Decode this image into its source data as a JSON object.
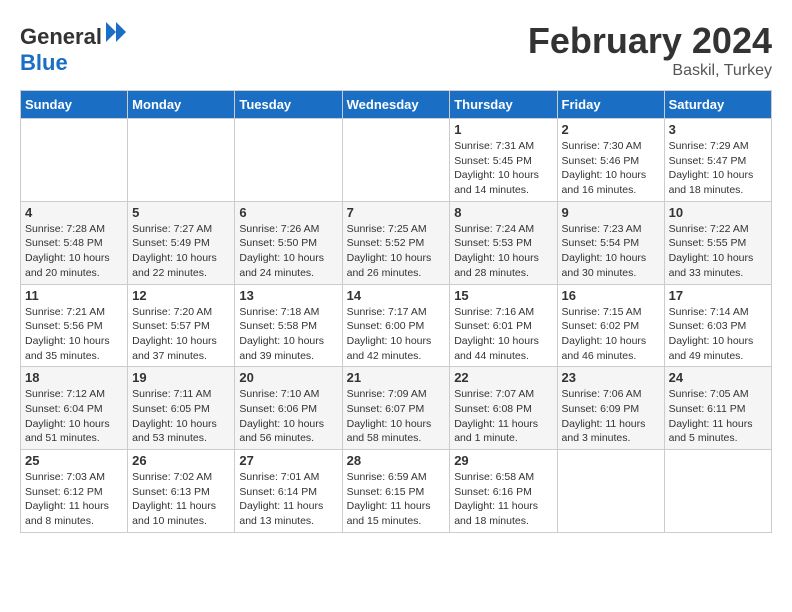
{
  "logo": {
    "text_general": "General",
    "text_blue": "Blue"
  },
  "header": {
    "month_year": "February 2024",
    "location": "Baskil, Turkey"
  },
  "days_of_week": [
    "Sunday",
    "Monday",
    "Tuesday",
    "Wednesday",
    "Thursday",
    "Friday",
    "Saturday"
  ],
  "weeks": [
    [
      {
        "day": "",
        "info": ""
      },
      {
        "day": "",
        "info": ""
      },
      {
        "day": "",
        "info": ""
      },
      {
        "day": "",
        "info": ""
      },
      {
        "day": "1",
        "info": "Sunrise: 7:31 AM\nSunset: 5:45 PM\nDaylight: 10 hours and 14 minutes."
      },
      {
        "day": "2",
        "info": "Sunrise: 7:30 AM\nSunset: 5:46 PM\nDaylight: 10 hours and 16 minutes."
      },
      {
        "day": "3",
        "info": "Sunrise: 7:29 AM\nSunset: 5:47 PM\nDaylight: 10 hours and 18 minutes."
      }
    ],
    [
      {
        "day": "4",
        "info": "Sunrise: 7:28 AM\nSunset: 5:48 PM\nDaylight: 10 hours and 20 minutes."
      },
      {
        "day": "5",
        "info": "Sunrise: 7:27 AM\nSunset: 5:49 PM\nDaylight: 10 hours and 22 minutes."
      },
      {
        "day": "6",
        "info": "Sunrise: 7:26 AM\nSunset: 5:50 PM\nDaylight: 10 hours and 24 minutes."
      },
      {
        "day": "7",
        "info": "Sunrise: 7:25 AM\nSunset: 5:52 PM\nDaylight: 10 hours and 26 minutes."
      },
      {
        "day": "8",
        "info": "Sunrise: 7:24 AM\nSunset: 5:53 PM\nDaylight: 10 hours and 28 minutes."
      },
      {
        "day": "9",
        "info": "Sunrise: 7:23 AM\nSunset: 5:54 PM\nDaylight: 10 hours and 30 minutes."
      },
      {
        "day": "10",
        "info": "Sunrise: 7:22 AM\nSunset: 5:55 PM\nDaylight: 10 hours and 33 minutes."
      }
    ],
    [
      {
        "day": "11",
        "info": "Sunrise: 7:21 AM\nSunset: 5:56 PM\nDaylight: 10 hours and 35 minutes."
      },
      {
        "day": "12",
        "info": "Sunrise: 7:20 AM\nSunset: 5:57 PM\nDaylight: 10 hours and 37 minutes."
      },
      {
        "day": "13",
        "info": "Sunrise: 7:18 AM\nSunset: 5:58 PM\nDaylight: 10 hours and 39 minutes."
      },
      {
        "day": "14",
        "info": "Sunrise: 7:17 AM\nSunset: 6:00 PM\nDaylight: 10 hours and 42 minutes."
      },
      {
        "day": "15",
        "info": "Sunrise: 7:16 AM\nSunset: 6:01 PM\nDaylight: 10 hours and 44 minutes."
      },
      {
        "day": "16",
        "info": "Sunrise: 7:15 AM\nSunset: 6:02 PM\nDaylight: 10 hours and 46 minutes."
      },
      {
        "day": "17",
        "info": "Sunrise: 7:14 AM\nSunset: 6:03 PM\nDaylight: 10 hours and 49 minutes."
      }
    ],
    [
      {
        "day": "18",
        "info": "Sunrise: 7:12 AM\nSunset: 6:04 PM\nDaylight: 10 hours and 51 minutes."
      },
      {
        "day": "19",
        "info": "Sunrise: 7:11 AM\nSunset: 6:05 PM\nDaylight: 10 hours and 53 minutes."
      },
      {
        "day": "20",
        "info": "Sunrise: 7:10 AM\nSunset: 6:06 PM\nDaylight: 10 hours and 56 minutes."
      },
      {
        "day": "21",
        "info": "Sunrise: 7:09 AM\nSunset: 6:07 PM\nDaylight: 10 hours and 58 minutes."
      },
      {
        "day": "22",
        "info": "Sunrise: 7:07 AM\nSunset: 6:08 PM\nDaylight: 11 hours and 1 minute."
      },
      {
        "day": "23",
        "info": "Sunrise: 7:06 AM\nSunset: 6:09 PM\nDaylight: 11 hours and 3 minutes."
      },
      {
        "day": "24",
        "info": "Sunrise: 7:05 AM\nSunset: 6:11 PM\nDaylight: 11 hours and 5 minutes."
      }
    ],
    [
      {
        "day": "25",
        "info": "Sunrise: 7:03 AM\nSunset: 6:12 PM\nDaylight: 11 hours and 8 minutes."
      },
      {
        "day": "26",
        "info": "Sunrise: 7:02 AM\nSunset: 6:13 PM\nDaylight: 11 hours and 10 minutes."
      },
      {
        "day": "27",
        "info": "Sunrise: 7:01 AM\nSunset: 6:14 PM\nDaylight: 11 hours and 13 minutes."
      },
      {
        "day": "28",
        "info": "Sunrise: 6:59 AM\nSunset: 6:15 PM\nDaylight: 11 hours and 15 minutes."
      },
      {
        "day": "29",
        "info": "Sunrise: 6:58 AM\nSunset: 6:16 PM\nDaylight: 11 hours and 18 minutes."
      },
      {
        "day": "",
        "info": ""
      },
      {
        "day": "",
        "info": ""
      }
    ]
  ]
}
